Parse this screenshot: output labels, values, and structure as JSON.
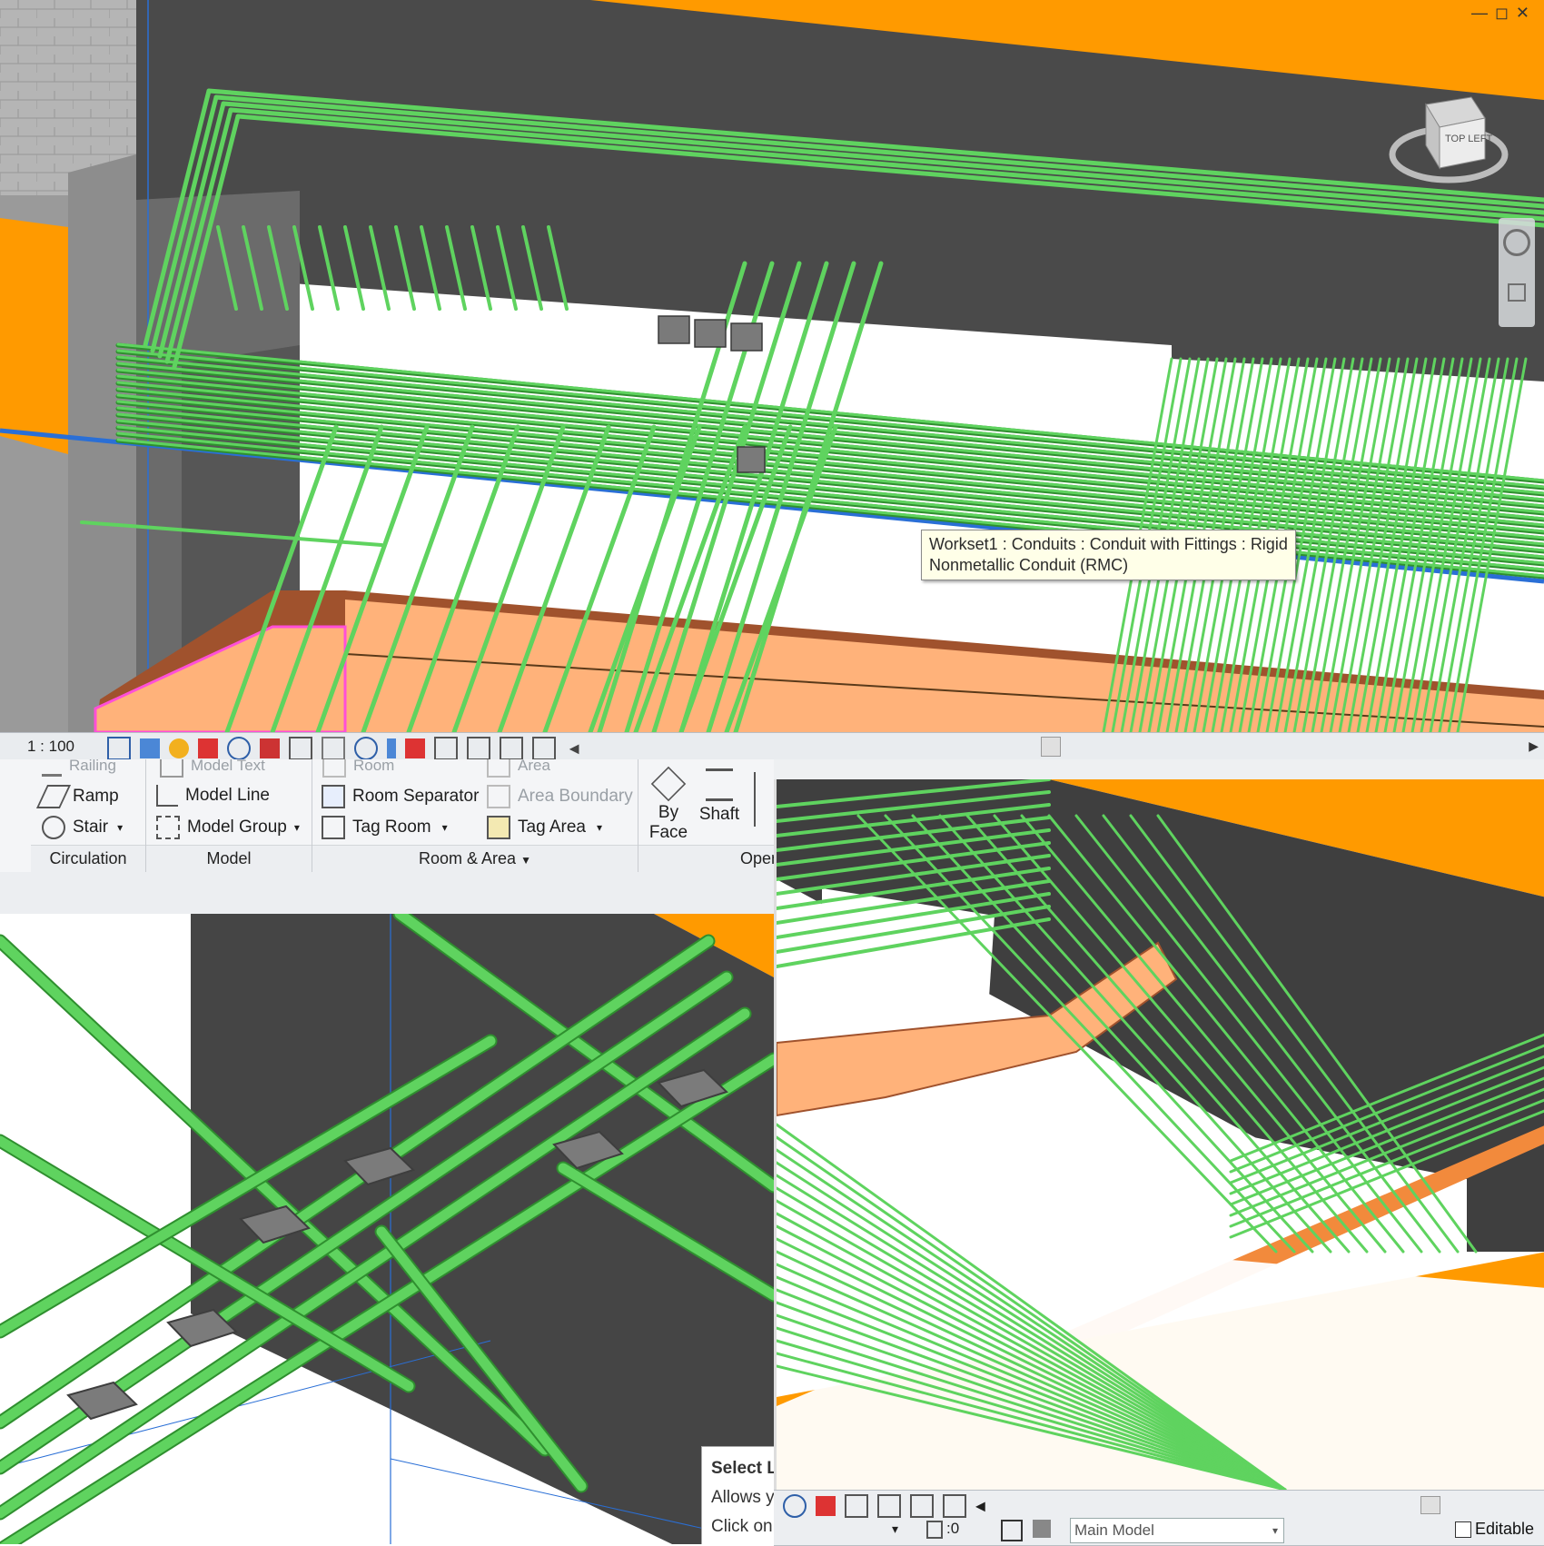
{
  "top_view": {
    "scale_label": "1 : 100",
    "tooltip": {
      "line1": "Workset1 : Conduits : Conduit with Fittings : Rigid",
      "line2": "Nonmetallic Conduit (RMC)"
    },
    "viewcube_label": "TOP LEFT",
    "window_controls": {
      "minimize": "—",
      "restore": "◻",
      "close": "✕"
    }
  },
  "ribbon": {
    "circulation": {
      "railing_label": "Railing",
      "ramp_label": "Ramp",
      "stair_label": "Stair",
      "group_label": "Circulation"
    },
    "model": {
      "model_text_label": "Model Text",
      "model_line_label": "Model Line",
      "model_group_label": "Model Group",
      "group_label": "Model"
    },
    "room_area": {
      "room_label": "Room",
      "area_label": "Area",
      "room_separator_label": "Room Separator",
      "area_boundary_label": "Area Boundary",
      "tag_room_label": "Tag Room",
      "tag_area_label": "Tag Area",
      "group_label": "Room & Area"
    },
    "opening": {
      "by_face_line1": "By",
      "by_face_line2": "Face",
      "shaft_label": "Shaft",
      "group_label": "Opening"
    }
  },
  "bottom_left": {
    "tooltip_title": "Select L",
    "tooltip_line": "Allows y",
    "tooltip_click": "Click on"
  },
  "bottom_right_status": {
    "counter": ":0",
    "model_select": "Main Model",
    "editable_label": "Editable"
  },
  "colors": {
    "conduit_green": "#5fd35f",
    "conduit_dark": "#2f8f2f",
    "floor_orange": "#ff9900",
    "slab_dark": "#454545",
    "cable_tray": "#ffb27a",
    "tray_edge": "#a0522d",
    "gridline_blue": "#2a6fd6"
  }
}
